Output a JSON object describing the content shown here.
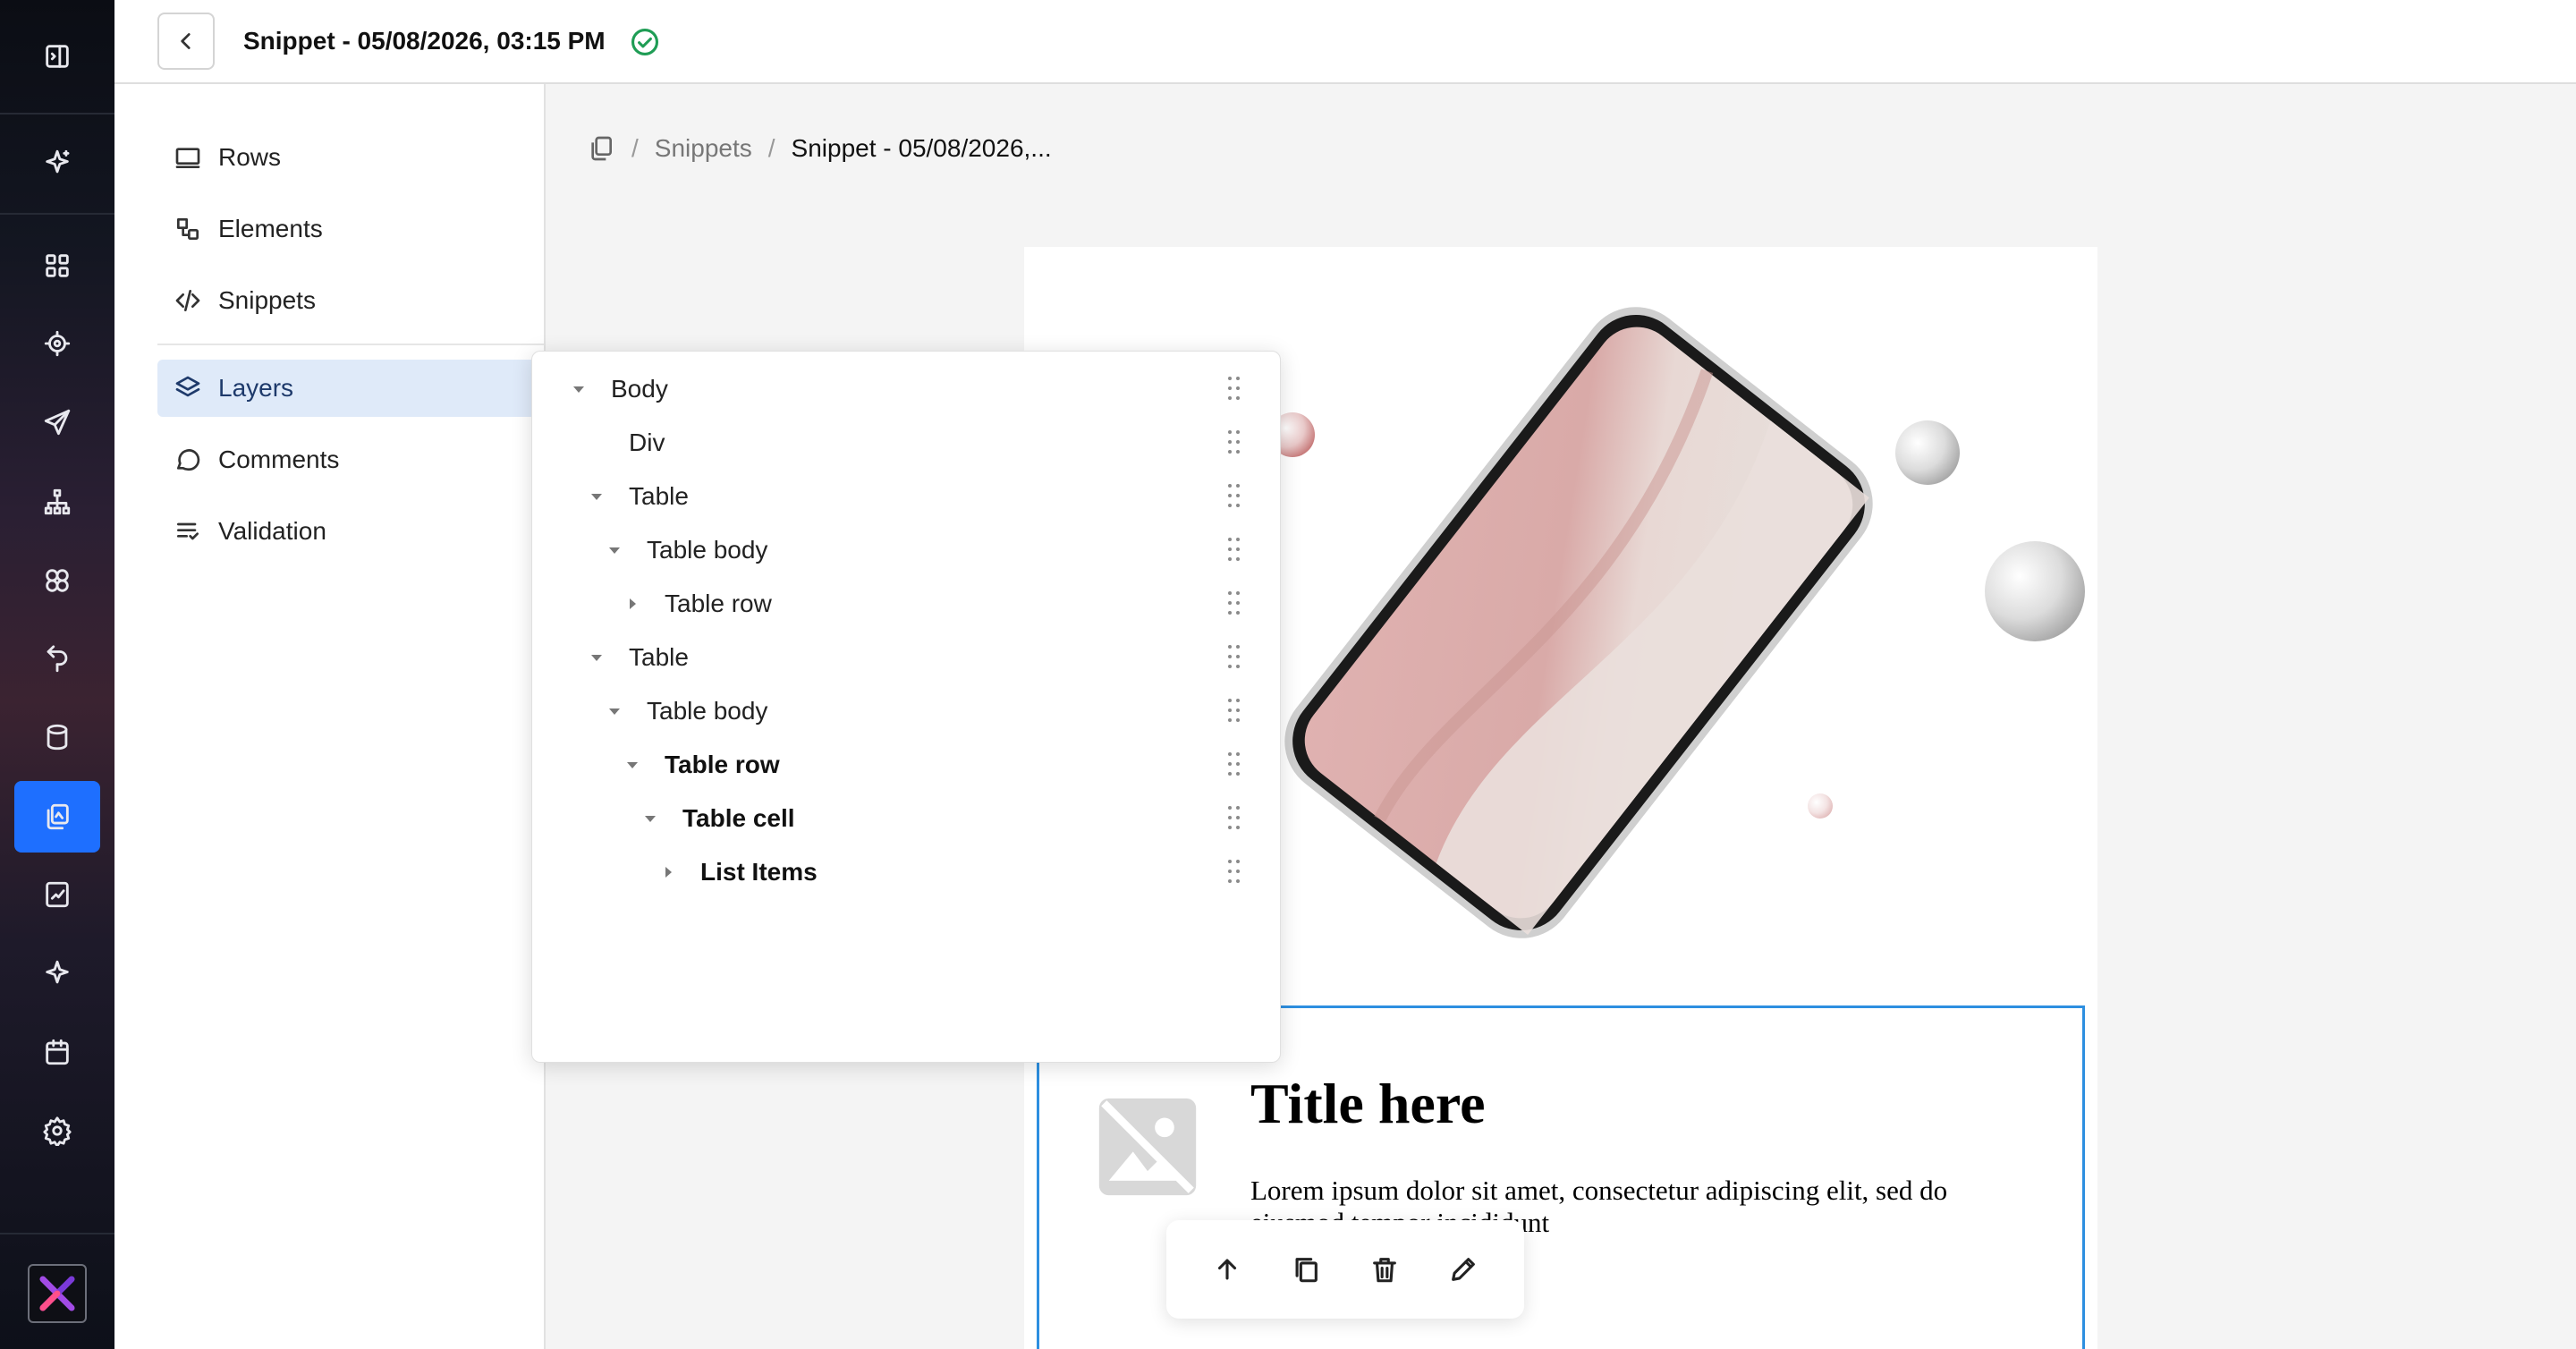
{
  "topbar": {
    "title": "Snippet - 05/08/2026, 03:15 PM",
    "status": "saved"
  },
  "rail": {
    "items": [
      "sidebar-toggle-icon",
      "sparkle-icon",
      "dashboard-icon",
      "target-icon",
      "send-icon",
      "hierarchy-icon",
      "circles-icon",
      "return-icon",
      "database-icon",
      "templates-icon",
      "chart-icon",
      "ai-sparkle-icon",
      "calendar-icon",
      "settings-icon"
    ],
    "active": "templates-icon",
    "accent": "#1e6fff"
  },
  "sidepanel": {
    "items": [
      {
        "label": "Rows",
        "icon": "rows-icon"
      },
      {
        "label": "Elements",
        "icon": "elements-icon"
      },
      {
        "label": "Snippets",
        "icon": "code-icon"
      },
      {
        "label": "Layers",
        "icon": "layers-icon",
        "active": true
      },
      {
        "label": "Comments",
        "icon": "comment-icon"
      },
      {
        "label": "Validation",
        "icon": "validation-icon"
      }
    ]
  },
  "breadcrumb": {
    "root": "Snippets",
    "current": "Snippet - 05/08/2026,..."
  },
  "layers": [
    {
      "label": "Body",
      "depth": 0,
      "caret": "down",
      "bold": false
    },
    {
      "label": "Div",
      "depth": 1,
      "caret": "none",
      "bold": false
    },
    {
      "label": "Table",
      "depth": 1,
      "caret": "down",
      "bold": false
    },
    {
      "label": "Table body",
      "depth": 2,
      "caret": "down",
      "bold": false
    },
    {
      "label": "Table row",
      "depth": 3,
      "caret": "right",
      "bold": false
    },
    {
      "label": "Table",
      "depth": 1,
      "caret": "down",
      "bold": false
    },
    {
      "label": "Table body",
      "depth": 2,
      "caret": "down",
      "bold": false
    },
    {
      "label": "Table row",
      "depth": 3,
      "caret": "down",
      "bold": true
    },
    {
      "label": "Table cell",
      "depth": 4,
      "caret": "down",
      "bold": true
    },
    {
      "label": "List Items",
      "depth": 5,
      "caret": "right",
      "bold": true
    }
  ],
  "canvas": {
    "block_title": "Title here",
    "block_text": "Lorem ipsum dolor sit amet, consectetur adipiscing elit, sed do eiusmod tempor incididunt"
  },
  "toolbar": {
    "buttons": [
      "arrow-up-icon",
      "copy-icon",
      "trash-icon",
      "pencil-icon"
    ]
  },
  "colors": {
    "selection_border": "#2d8fe0",
    "active_menu_bg": "#dfeaf9"
  }
}
